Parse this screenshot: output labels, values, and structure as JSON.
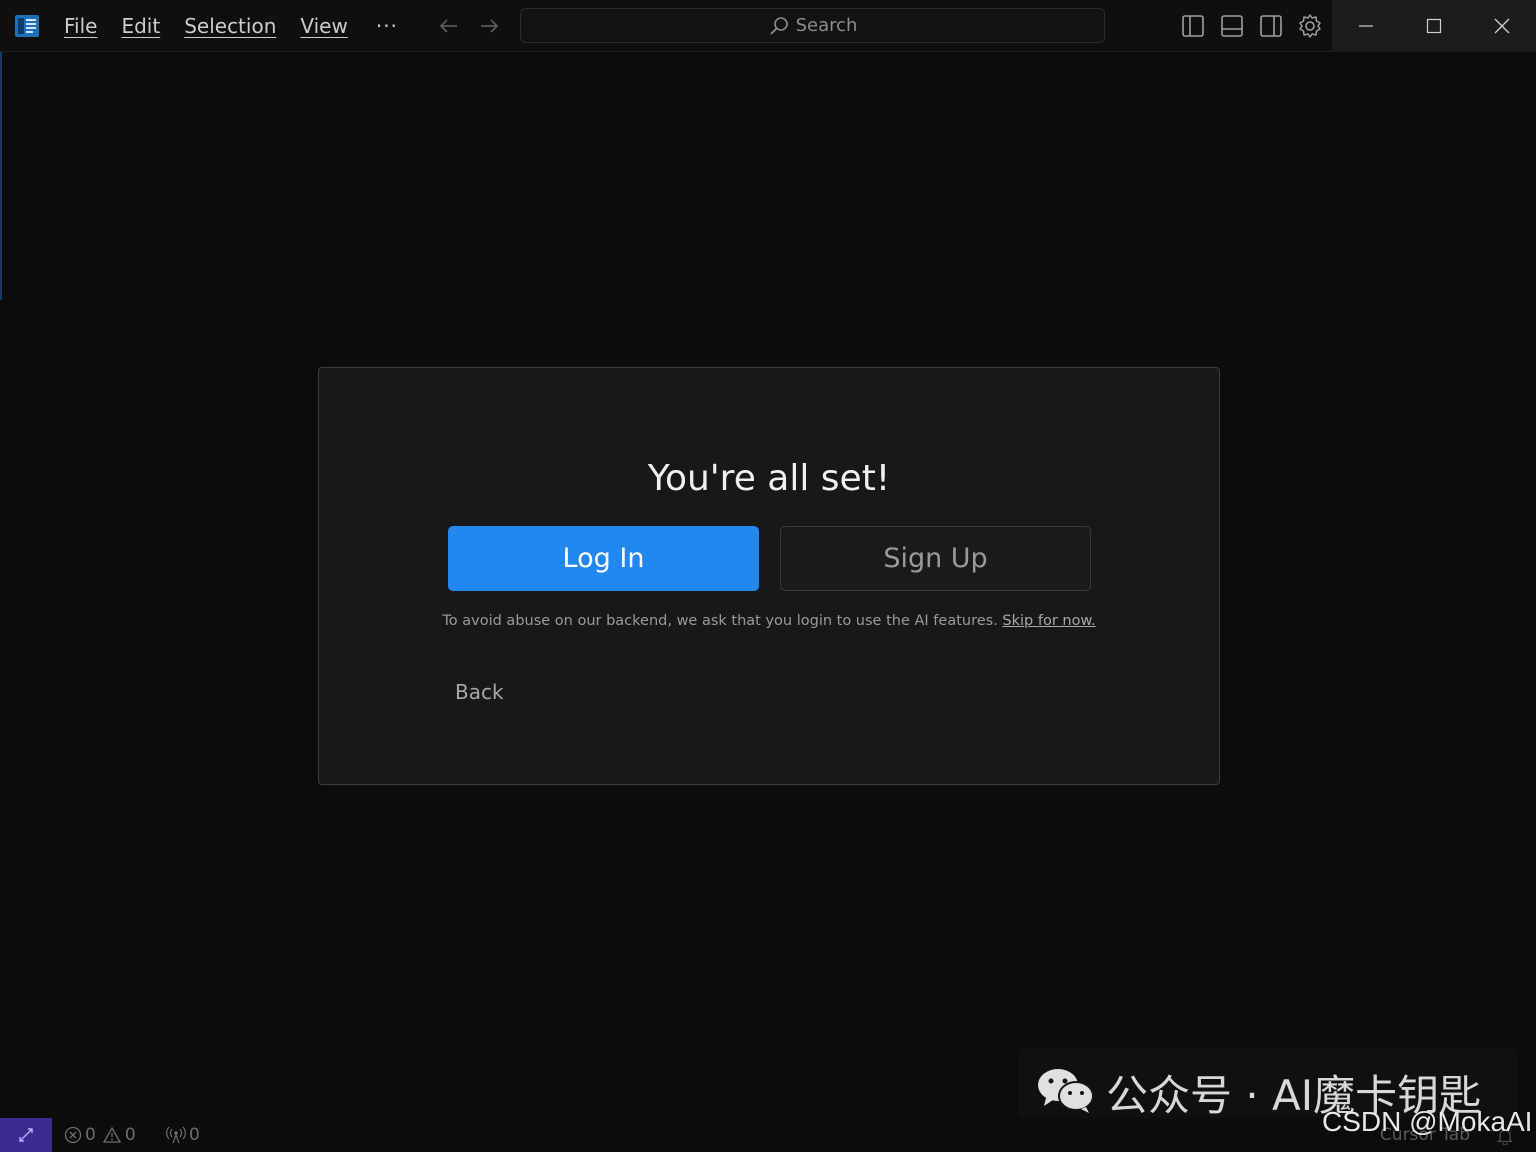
{
  "titlebar": {
    "menu": [
      {
        "label": "File"
      },
      {
        "label": "Edit"
      },
      {
        "label": "Selection"
      },
      {
        "label": "View"
      }
    ],
    "more_label": "···",
    "search": {
      "placeholder": "Search"
    },
    "icons": [
      "toggle-primary-sidebar-icon",
      "toggle-panel-icon",
      "toggle-secondary-sidebar-icon",
      "settings-gear-icon"
    ],
    "window_controls": [
      "minimize-icon",
      "maximize-icon",
      "close-icon"
    ]
  },
  "dialog": {
    "title": "You're all set!",
    "login_label": "Log In",
    "signup_label": "Sign Up",
    "notice_text": "To avoid abuse on our backend, we ask that you login to use the AI features.",
    "skip_label": "Skip for now.",
    "back_label": "Back"
  },
  "statusbar": {
    "errors": "0",
    "warnings": "0",
    "ports": "0",
    "cursor_tab": "Cursor Tab"
  },
  "watermark": {
    "wechat_text": "公众号 · AI魔卡钥匙",
    "csdn_text": "CSDN @MokaAI"
  },
  "colors": {
    "accent_blue": "#2288f0",
    "remote_purple": "#3b2d8f",
    "background": "#0c0c0c",
    "dialog_bg": "#181818"
  }
}
